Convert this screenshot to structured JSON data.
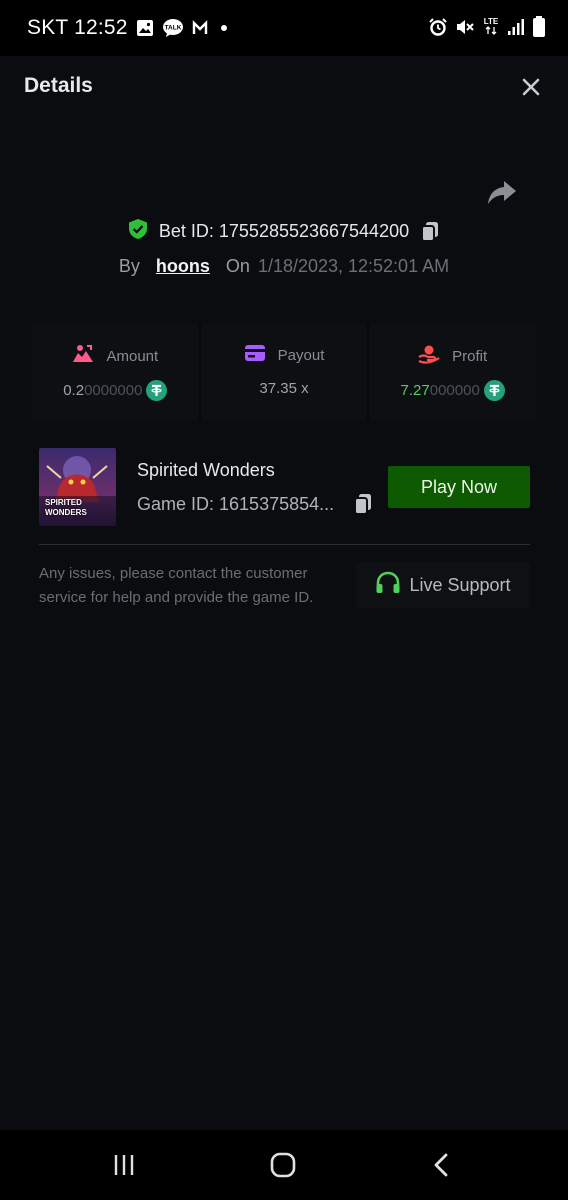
{
  "status_bar": {
    "carrier_time": "SKT 12:52",
    "left_icons": [
      "gallery-icon",
      "kakaotalk-icon",
      "gmail-icon",
      "dot-icon"
    ],
    "right_icons": [
      "alarm-icon",
      "mute-icon",
      "lte-icon",
      "signal-icon",
      "battery-icon"
    ],
    "network_label": "LTE"
  },
  "header": {
    "title": "Details"
  },
  "bet": {
    "id_text": "Bet ID: 1755285523667544200",
    "by_label": "By",
    "username": "hoons",
    "on_label": "On",
    "datetime": "1/18/2023, 12:52:01 AM"
  },
  "stats": {
    "amount": {
      "label": "Amount",
      "value_main": "0.2",
      "value_dim": "0000000"
    },
    "payout": {
      "label": "Payout",
      "value": "37.35 x"
    },
    "profit": {
      "label": "Profit",
      "value_main": "7.27",
      "value_dim": "000000"
    }
  },
  "game": {
    "name": "Spirited Wonders",
    "id_text": "Game ID: 1615375854...",
    "thumb_line1": "SPIRITED",
    "thumb_line2": "WONDERS",
    "play_label": "Play Now",
    "help_text": "Any issues, please contact the customer service for help and provide the game ID.",
    "support_label": "Live Support"
  },
  "colors": {
    "sheet_bg": "#0b0c0f",
    "play_button": "#0e5a00",
    "profit_green": "#4fd15a",
    "verified_green": "#2fbf3a",
    "amount_pink": "#ff5a8a",
    "payout_purple": "#a65cff",
    "profit_red": "#ff4e4e",
    "tether_teal": "#26a17b",
    "support_green": "#4fd15a"
  }
}
